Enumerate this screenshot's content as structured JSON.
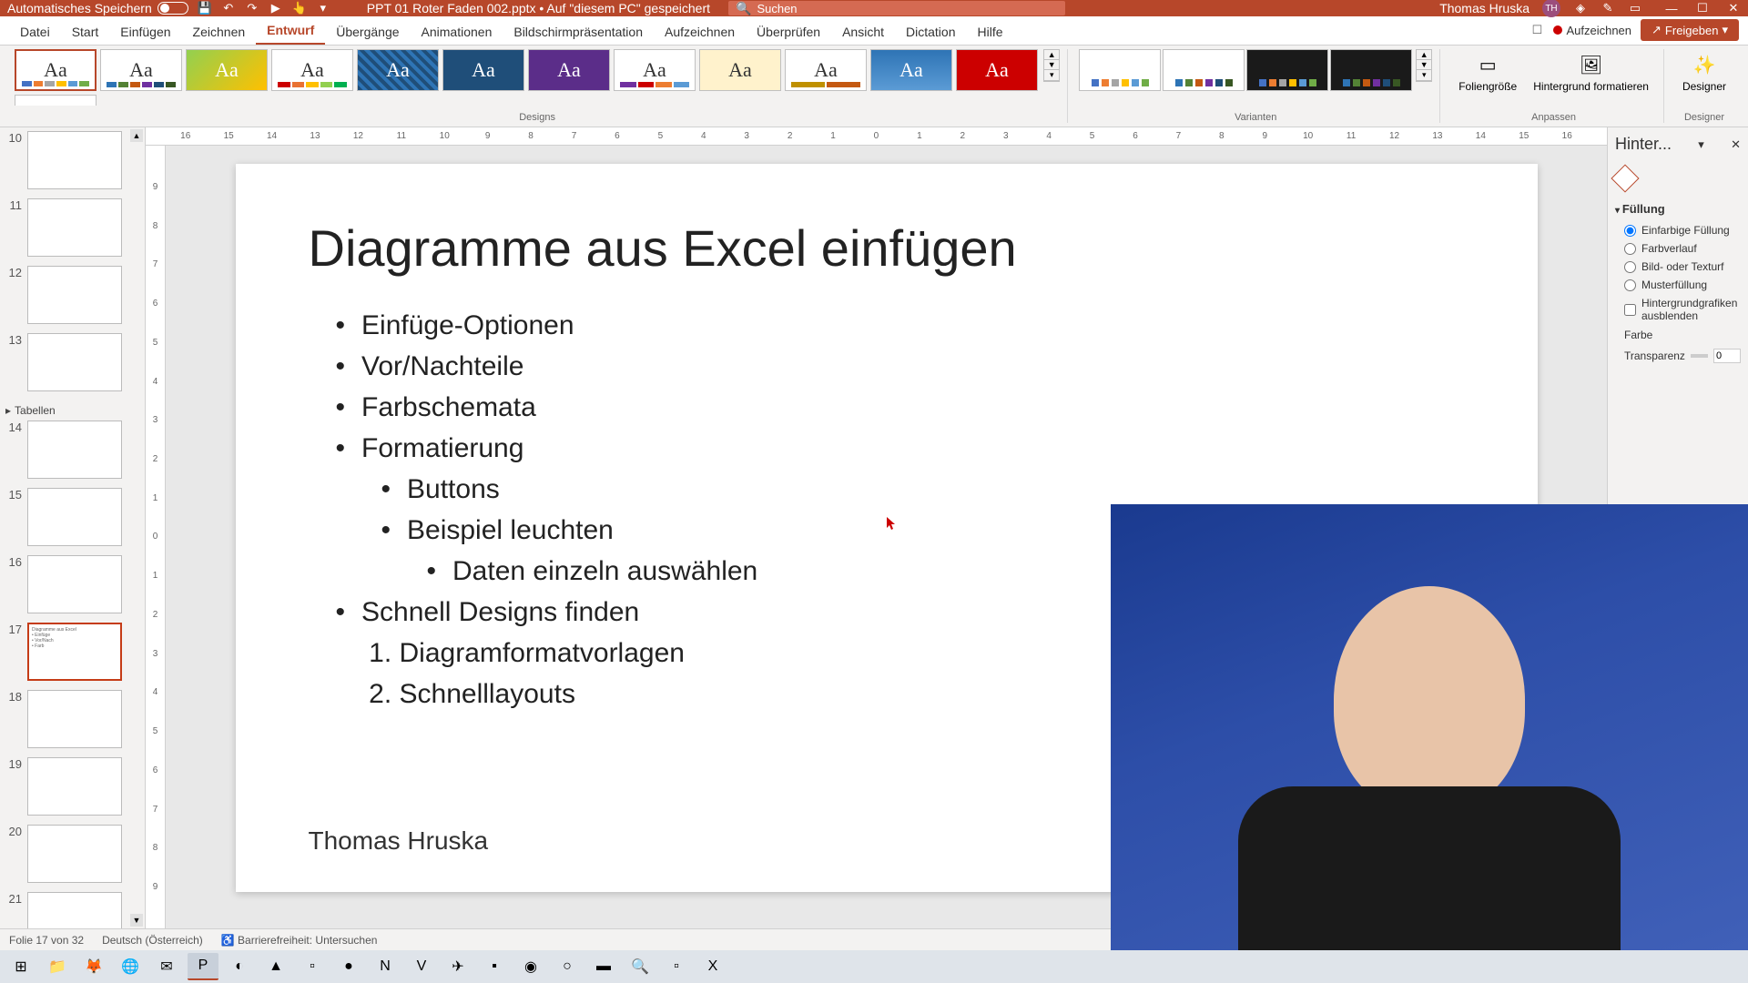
{
  "titlebar": {
    "autosave": "Automatisches Speichern",
    "doc_title": "PPT 01 Roter Faden 002.pptx • Auf \"diesem PC\" gespeichert",
    "search_placeholder": "Suchen",
    "user_name": "Thomas Hruska",
    "user_initials": "TH"
  },
  "tabs": {
    "items": [
      "Datei",
      "Start",
      "Einfügen",
      "Zeichnen",
      "Entwurf",
      "Übergänge",
      "Animationen",
      "Bildschirmpräsentation",
      "Aufzeichnen",
      "Überprüfen",
      "Ansicht",
      "Dictation",
      "Hilfe"
    ],
    "active_index": 4,
    "record_label": "Aufzeichnen",
    "share_label": "Freigeben"
  },
  "ribbon": {
    "designs_label": "Designs",
    "variants_label": "Varianten",
    "adjust_label": "Anpassen",
    "designer_label": "Designer",
    "slide_size": "Foliengröße",
    "format_bg": "Hintergrund formatieren",
    "designer_btn": "Designer"
  },
  "ruler_h": [
    "16",
    "15",
    "14",
    "13",
    "12",
    "11",
    "10",
    "9",
    "8",
    "7",
    "6",
    "5",
    "4",
    "3",
    "2",
    "1",
    "0",
    "1",
    "2",
    "3",
    "4",
    "5",
    "6",
    "7",
    "8",
    "9",
    "10",
    "11",
    "12",
    "13",
    "14",
    "15",
    "16"
  ],
  "ruler_v": [
    "9",
    "8",
    "7",
    "6",
    "5",
    "4",
    "3",
    "2",
    "1",
    "0",
    "1",
    "2",
    "3",
    "4",
    "5",
    "6",
    "7",
    "8",
    "9"
  ],
  "thumbnails": {
    "section": "Tabellen",
    "items": [
      {
        "num": "10"
      },
      {
        "num": "11"
      },
      {
        "num": "12"
      },
      {
        "num": "13"
      },
      {
        "num": "14"
      },
      {
        "num": "15"
      },
      {
        "num": "16"
      },
      {
        "num": "17",
        "selected": true
      },
      {
        "num": "18"
      },
      {
        "num": "19"
      },
      {
        "num": "20"
      },
      {
        "num": "21"
      }
    ]
  },
  "slide": {
    "title": "Diagramme aus Excel einfügen",
    "bullets_l1": [
      "Einfüge-Optionen",
      "Vor/Nachteile",
      "Farbschemata",
      "Formatierung"
    ],
    "bullets_l2": [
      "Buttons",
      "Beispiel leuchten"
    ],
    "bullets_l3": [
      "Daten einzeln auswählen"
    ],
    "bullet_after": "Schnell Designs finden",
    "numbered": [
      "Diagramformatvorlagen",
      "Schnelllayouts"
    ],
    "footer": "Thomas Hruska"
  },
  "right_pane": {
    "title": "Hinter...",
    "fill_section": "Füllung",
    "opt_solid": "Einfarbige Füllung",
    "opt_gradient": "Farbverlauf",
    "opt_picture": "Bild- oder Texturf",
    "opt_pattern": "Musterfüllung",
    "opt_hide": "Hintergrundgrafiken ausblenden",
    "color_label": "Farbe",
    "transparency_label": "Transparenz",
    "transparency_value": "0"
  },
  "statusbar": {
    "slide_info": "Folie 17 von 32",
    "language": "Deutsch (Österreich)",
    "accessibility": "Barrierefreiheit: Untersuchen"
  }
}
